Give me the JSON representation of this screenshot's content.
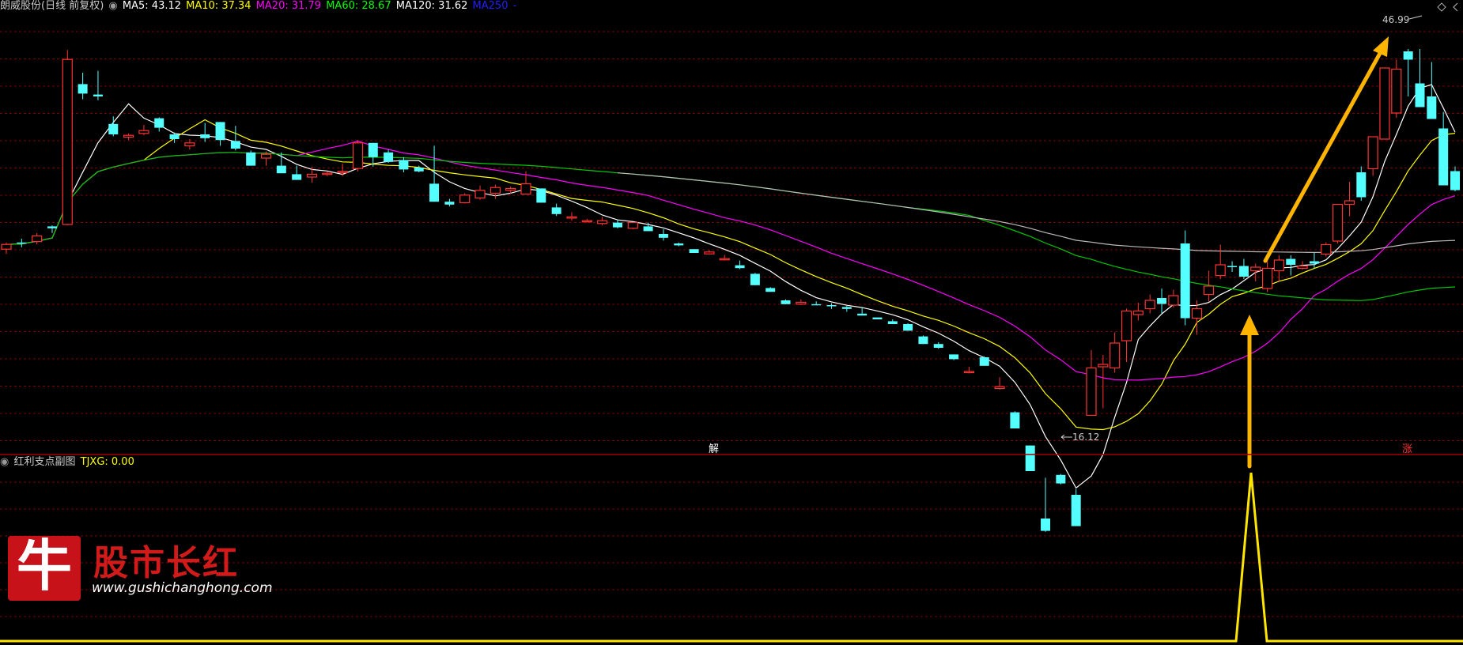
{
  "header": {
    "title": "朗威股份(日线 前复权)",
    "ma_items": [
      {
        "label": "MA5: 43.12",
        "color": "#ffffff"
      },
      {
        "label": "MA10: 37.34",
        "color": "#ffff00"
      },
      {
        "label": "MA20: 31.79",
        "color": "#ff00ff"
      },
      {
        "label": "MA60: 28.67",
        "color": "#00ff00"
      },
      {
        "label": "MA120: 31.62",
        "color": "#ffffff"
      },
      {
        "label": "MA250",
        "color": "#0000ff"
      },
      {
        "label": "-",
        "color": "#0000ff"
      }
    ]
  },
  "sub_header": {
    "title": "红利支点副图",
    "indicator": "TJXG: 0.00",
    "indicator_color": "#ffff00"
  },
  "markers": {
    "high_label": "46.99",
    "low_label": "16.12",
    "jie": "解",
    "zhang": "涨"
  },
  "logo": {
    "glyph": "牛",
    "title": "股市长红",
    "url": "www.gushichanghong.com"
  },
  "colors": {
    "up": "#ff3232",
    "down": "#54ffff",
    "grid": "#7a0000",
    "arrow": "#ffb400",
    "signal": "#ffe600"
  },
  "chart_data": {
    "type": "candlestick",
    "price_range": [
      14,
      50
    ],
    "candles": [
      [
        14.4,
        15.1,
        13.9,
        14.9
      ],
      [
        15.1,
        15.5,
        14.6,
        15.0
      ],
      [
        15.2,
        16.1,
        14.9,
        15.8
      ],
      [
        16.8,
        16.9,
        16.1,
        16.6
      ],
      [
        17.0,
        35.4,
        16.9,
        34.4
      ],
      [
        31.8,
        33.0,
        30.2,
        30.8
      ],
      [
        30.7,
        33.2,
        30.1,
        30.5
      ],
      [
        27.6,
        28.4,
        26.3,
        26.5
      ],
      [
        26.2,
        26.6,
        25.9,
        26.4
      ],
      [
        26.6,
        27.5,
        26.4,
        26.9
      ],
      [
        28.2,
        28.3,
        26.8,
        27.2
      ],
      [
        26.5,
        26.7,
        25.6,
        26.0
      ],
      [
        25.3,
        26.0,
        24.9,
        25.6
      ],
      [
        26.5,
        27.7,
        25.7,
        26.1
      ],
      [
        27.8,
        27.8,
        25.3,
        25.9
      ],
      [
        25.8,
        27.4,
        24.8,
        25.0
      ],
      [
        24.6,
        24.8,
        23.2,
        23.2
      ],
      [
        24.0,
        24.7,
        23.2,
        24.4
      ],
      [
        23.2,
        24.6,
        22.4,
        22.4
      ],
      [
        22.3,
        23.2,
        21.7,
        21.7
      ],
      [
        22.0,
        23.1,
        21.4,
        22.3
      ],
      [
        22.4,
        22.6,
        22.1,
        22.4
      ],
      [
        22.6,
        23.4,
        22.1,
        22.6
      ],
      [
        22.9,
        25.9,
        22.6,
        25.6
      ],
      [
        25.6,
        25.6,
        23.1,
        24.1
      ],
      [
        24.6,
        24.9,
        23.5,
        23.6
      ],
      [
        23.8,
        24.1,
        22.5,
        22.8
      ],
      [
        23.0,
        23.2,
        22.5,
        22.6
      ],
      [
        21.3,
        25.3,
        19.4,
        19.4
      ],
      [
        19.4,
        19.7,
        18.9,
        19.1
      ],
      [
        19.3,
        20.3,
        19.2,
        20.1
      ],
      [
        19.8,
        21.1,
        19.6,
        20.6
      ],
      [
        20.3,
        21.2,
        19.7,
        20.9
      ],
      [
        20.6,
        21.0,
        20.2,
        20.8
      ],
      [
        20.2,
        22.6,
        20.2,
        21.3
      ],
      [
        20.8,
        20.8,
        19.3,
        19.3
      ],
      [
        18.8,
        19.2,
        17.9,
        18.1
      ],
      [
        17.8,
        18.3,
        17.4,
        17.8
      ],
      [
        17.4,
        17.6,
        17.2,
        17.4
      ],
      [
        17.1,
        17.8,
        16.9,
        17.4
      ],
      [
        17.2,
        17.5,
        16.6,
        16.7
      ],
      [
        16.6,
        17.2,
        16.5,
        17.2
      ],
      [
        16.8,
        17.2,
        16.3,
        16.3
      ],
      [
        16.0,
        16.5,
        15.3,
        15.6
      ],
      [
        15.0,
        15.1,
        14.7,
        14.8
      ],
      [
        14.4,
        14.4,
        14.0,
        14.0
      ],
      [
        13.9,
        14.3,
        13.9,
        14.1
      ],
      [
        13.4,
        13.8,
        13.2,
        13.4
      ],
      [
        12.7,
        13.2,
        12.3,
        12.4
      ],
      [
        11.8,
        11.9,
        10.6,
        10.6
      ],
      [
        10.3,
        10.4,
        9.9,
        9.9
      ],
      [
        9.0,
        9.1,
        8.6,
        8.6
      ],
      [
        8.6,
        9.1,
        8.5,
        8.8
      ],
      [
        8.6,
        8.9,
        8.5,
        8.5
      ],
      [
        8.5,
        8.7,
        8.1,
        8.4
      ],
      [
        8.3,
        8.4,
        7.8,
        8.1
      ],
      [
        7.6,
        8.3,
        7.4,
        7.4
      ],
      [
        7.2,
        7.2,
        7.0,
        7.0
      ],
      [
        6.8,
        7.0,
        6.5,
        6.5
      ],
      [
        6.5,
        6.6,
        5.8,
        5.8
      ],
      [
        5.2,
        5.3,
        4.4,
        4.4
      ],
      [
        4.4,
        4.6,
        3.9,
        4.0
      ],
      [
        3.3,
        3.3,
        2.7,
        2.8
      ],
      [
        1.4,
        2.0,
        1.3,
        1.5
      ],
      [
        3.0,
        3.1,
        2.1,
        2.1
      ],
      [
        -0.3,
        0.9,
        -0.4,
        -0.1
      ],
      [
        -2.8,
        -2.7,
        -4.5,
        -4.5
      ],
      [
        -6.3,
        -6.3,
        -9.0,
        -9.0
      ],
      [
        -14.0,
        -9.7,
        -15.4,
        -15.3
      ],
      [
        -9.4,
        -9.3,
        -10.4,
        -10.3
      ],
      [
        -11.5,
        -10.9,
        -14.8,
        -14.8
      ]
    ],
    "candles_right": [
      [
        16.3,
        21.8,
        16.3,
        20.3
      ],
      [
        20.4,
        21.4,
        16.9,
        20.6
      ],
      [
        20.3,
        23.3,
        19.9,
        22.4
      ],
      [
        22.6,
        25.3,
        20.8,
        25.1
      ],
      [
        24.8,
        25.8,
        24.3,
        25.1
      ],
      [
        25.3,
        26.5,
        24.9,
        26.0
      ],
      [
        26.2,
        27.0,
        24.9,
        25.7
      ],
      [
        25.6,
        26.9,
        25.4,
        26.4
      ],
      [
        30.8,
        31.9,
        23.9,
        24.5
      ],
      [
        24.5,
        26.0,
        23.1,
        25.3
      ],
      [
        26.5,
        28.5,
        25.9,
        27.2
      ],
      [
        28.1,
        30.7,
        27.8,
        29.0
      ],
      [
        28.9,
        29.3,
        28.4,
        28.8
      ],
      [
        28.9,
        29.5,
        27.8,
        28.0
      ],
      [
        28.5,
        29.1,
        27.6,
        28.8
      ],
      [
        27.0,
        29.3,
        26.7,
        28.7
      ],
      [
        28.5,
        29.8,
        27.6,
        29.4
      ],
      [
        29.5,
        29.8,
        28.1,
        29.0
      ],
      [
        28.7,
        29.3,
        28.6,
        28.9
      ],
      [
        29.3,
        30.0,
        28.7,
        29.1
      ],
      [
        29.9,
        30.9,
        29.7,
        30.7
      ],
      [
        31.0,
        34.1,
        30.8,
        34.1
      ],
      [
        34.1,
        36.0,
        33.1,
        34.4
      ],
      [
        36.8,
        37.3,
        34.4,
        34.7
      ],
      [
        37.1,
        39.7,
        36.5,
        39.8
      ],
      [
        39.6,
        45.6,
        39.6,
        45.6
      ],
      [
        41.8,
        46.3,
        41.4,
        45.5
      ],
      [
        47.0,
        47.2,
        43.2,
        46.3
      ],
      [
        44.3,
        47.2,
        42.3,
        42.3
      ],
      [
        43.2,
        46.1,
        41.4,
        41.3
      ],
      [
        40.5,
        41.9,
        35.7,
        35.7
      ],
      [
        36.9,
        37.3,
        35.2,
        35.3
      ]
    ]
  }
}
